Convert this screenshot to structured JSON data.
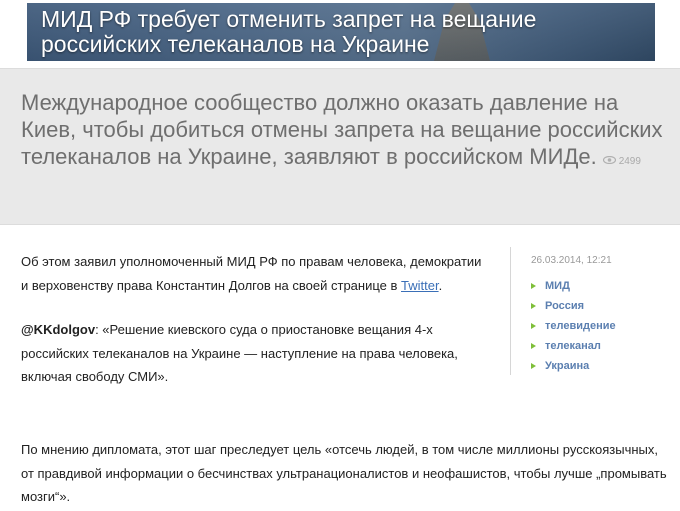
{
  "banner": {
    "title_line1": "МИД РФ требует отменить запрет на вещание",
    "title_line2": "российских телеканалов на Украине"
  },
  "lead": {
    "text": "Международное сообщество должно оказать давление на Киев, чтобы добиться отмены запрета на вещание российских телеканалов на Украине, заявляют в российском МИДе.",
    "views": "2499"
  },
  "article": {
    "p1_text": "Об этом заявил уполномоченный МИД РФ по правам человека, демократии и верховенству права Константин Долгов на своей странице в ",
    "p1_link": "Twitter",
    "p1_end": ".",
    "p2_handle": "@KKdolgov",
    "p2_text": ": «Решение киевского суда о приостановке вещания 4-х российских телеканалов на Украине — наступление на права человека, включая свободу СМИ».",
    "p3_text": "По мнению дипломата, этот шаг преследует цель «отсечь людей, в том числе миллионы русскоязычных, от правдивой информации о бесчинствах ультранационалистов и неофашистов, чтобы лучше „промывать мозги“»."
  },
  "sidebar": {
    "date": "26.03.2014, 12:21",
    "tags": [
      "МИД",
      "Россия",
      "телевидение",
      "телеканал",
      "Украина"
    ]
  },
  "colors": {
    "link": "#3a6fb7",
    "tag": "#5b7fb0",
    "tag_arrow": "#7fbf3a"
  }
}
